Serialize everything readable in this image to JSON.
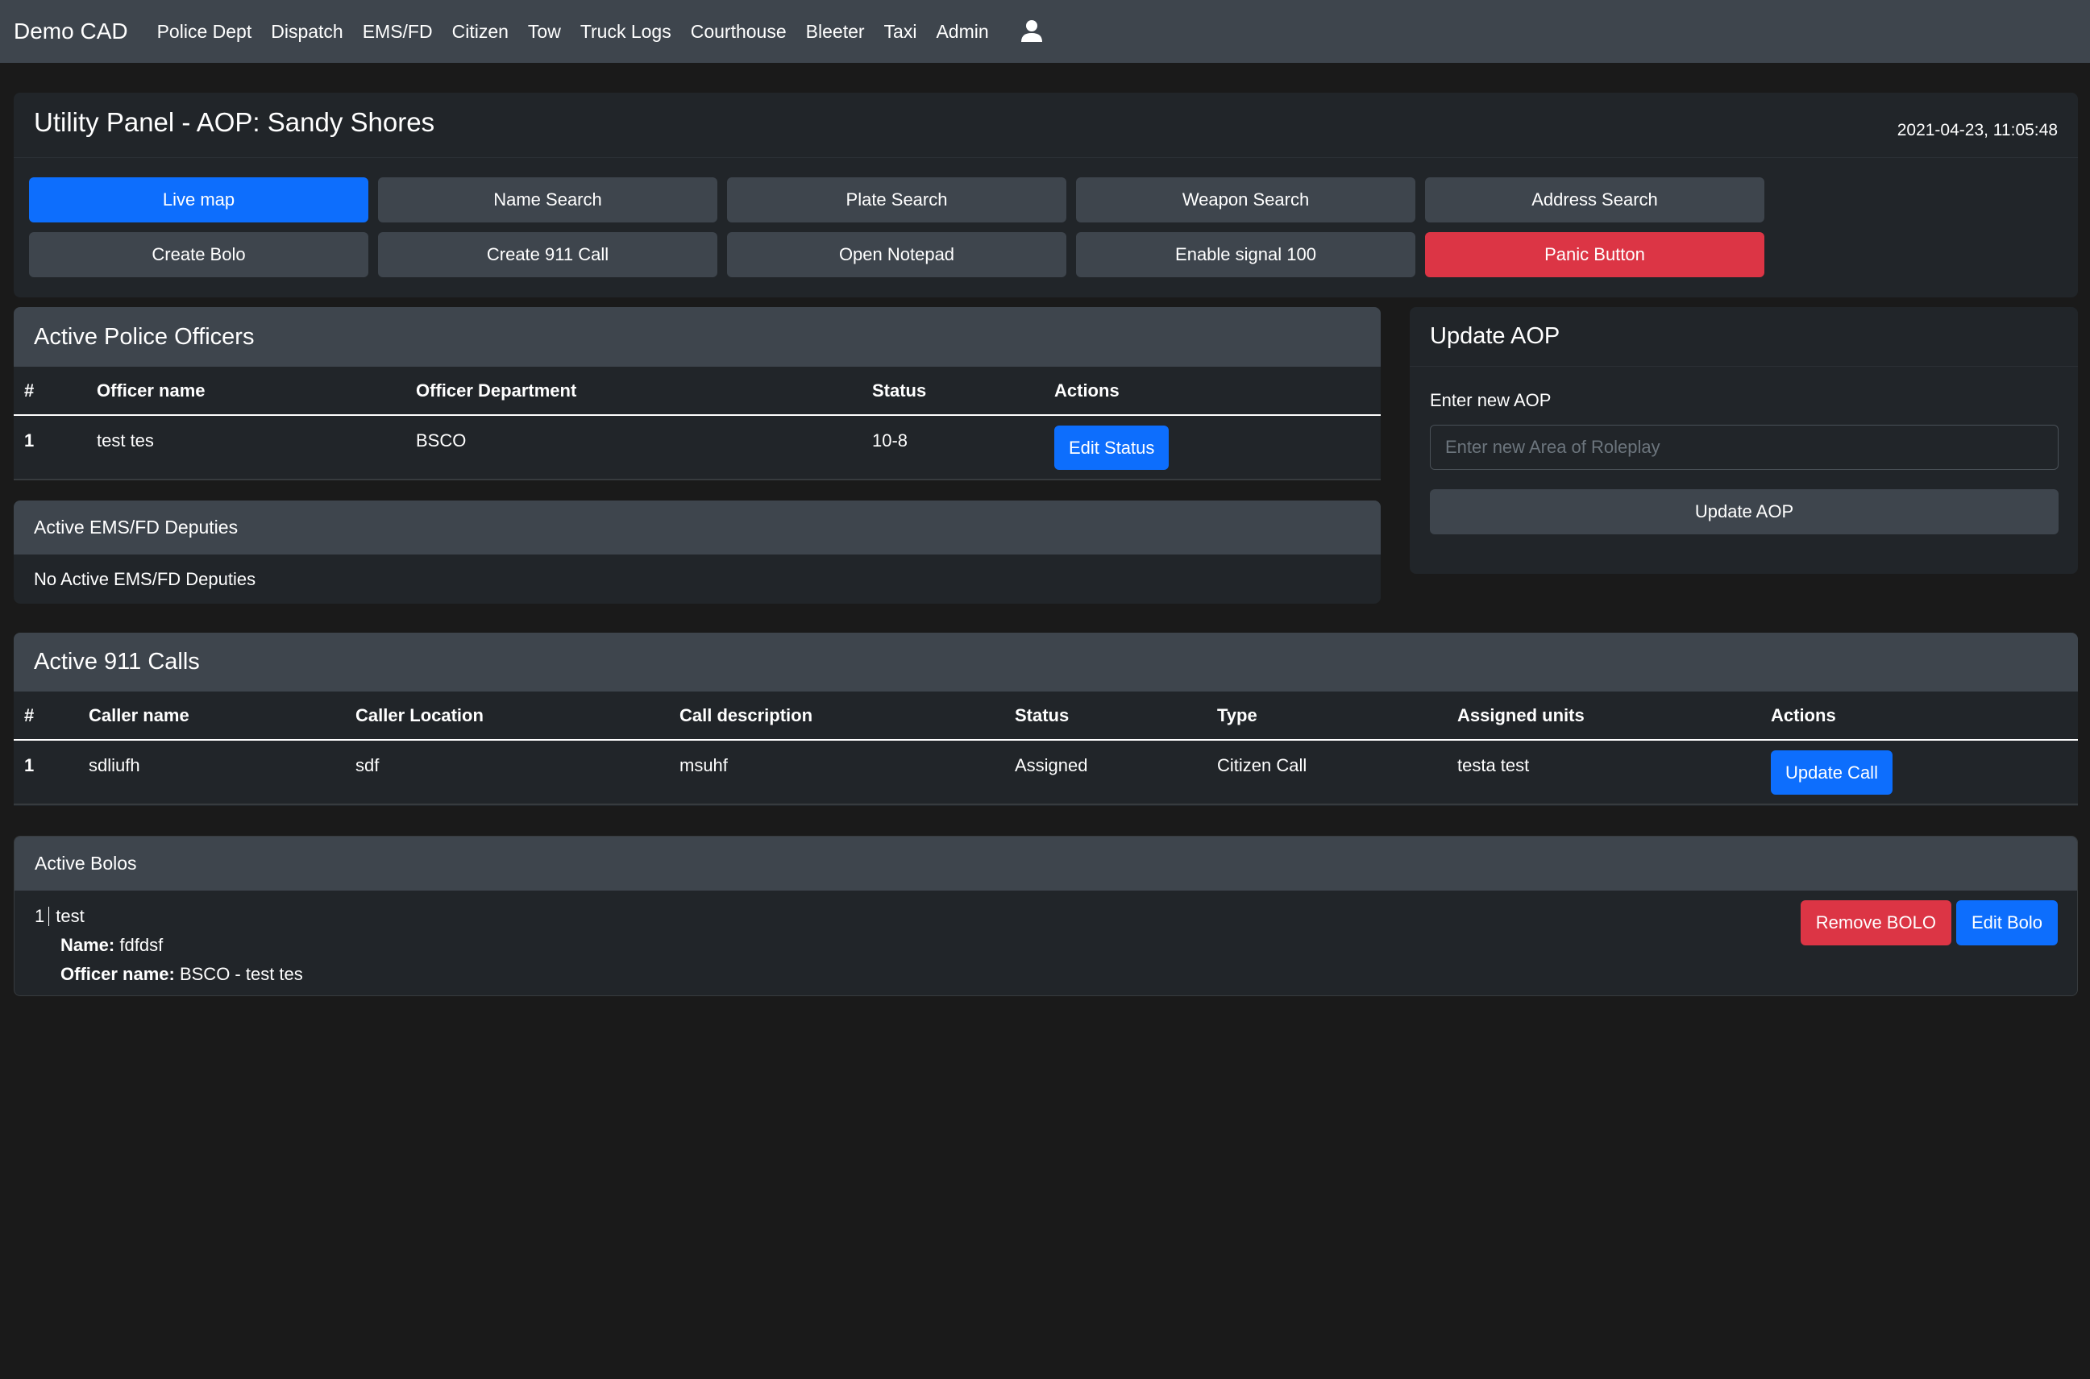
{
  "navbar": {
    "brand": "Demo CAD",
    "links": [
      "Police Dept",
      "Dispatch",
      "EMS/FD",
      "Citizen",
      "Tow",
      "Truck Logs",
      "Courthouse",
      "Bleeter",
      "Taxi",
      "Admin"
    ],
    "user_icon": "user-icon"
  },
  "utility": {
    "title": "Utility Panel - AOP: Sandy Shores",
    "timestamp": "2021-04-23, 11:05:48",
    "buttons": [
      {
        "label": "Live map",
        "style": "primary"
      },
      {
        "label": "Name Search",
        "style": "secondary"
      },
      {
        "label": "Plate Search",
        "style": "secondary"
      },
      {
        "label": "Weapon Search",
        "style": "secondary"
      },
      {
        "label": "Address Search",
        "style": "secondary"
      },
      {
        "label": "Create Bolo",
        "style": "secondary"
      },
      {
        "label": "Create 911 Call",
        "style": "secondary"
      },
      {
        "label": "Open Notepad",
        "style": "secondary"
      },
      {
        "label": "Enable signal 100",
        "style": "secondary"
      },
      {
        "label": "Panic Button",
        "style": "danger"
      }
    ]
  },
  "officers": {
    "title": "Active Police Officers",
    "columns": [
      "#",
      "Officer name",
      "Officer Department",
      "Status",
      "Actions"
    ],
    "rows": [
      {
        "num": "1",
        "name": "test tes",
        "department": "BSCO",
        "status": "10-8",
        "action": "Edit Status"
      }
    ]
  },
  "ems": {
    "title": "Active EMS/FD Deputies",
    "empty_text": "No Active EMS/FD Deputies"
  },
  "aop": {
    "title": "Update AOP",
    "label": "Enter new AOP",
    "placeholder": "Enter new Area of Roleplay",
    "value": "",
    "button": "Update AOP"
  },
  "calls": {
    "title": "Active 911 Calls",
    "columns": [
      "#",
      "Caller name",
      "Caller Location",
      "Call description",
      "Status",
      "Type",
      "Assigned units",
      "Actions"
    ],
    "rows": [
      {
        "num": "1",
        "caller": "sdliufh",
        "location": "sdf",
        "description": "msuhf",
        "status": "Assigned",
        "type": "Citizen Call",
        "units": "testa test",
        "action": "Update Call"
      }
    ]
  },
  "bolos": {
    "title": "Active Bolos",
    "items": [
      {
        "num": "1",
        "title": "test",
        "name_label": "Name:",
        "name": "fdfdsf",
        "officer_label": "Officer name:",
        "officer": "BSCO - test tes",
        "remove": "Remove BOLO",
        "edit": "Edit Bolo"
      }
    ]
  },
  "colors": {
    "primary": "#0d6efd",
    "secondary": "#3e454d",
    "danger": "#dc3545",
    "panel": "#212529",
    "background": "#1a1a1a"
  }
}
